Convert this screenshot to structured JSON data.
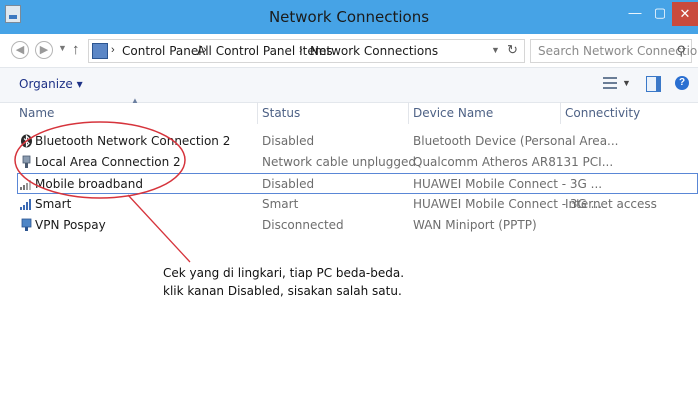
{
  "window": {
    "title": "Network Connections",
    "controls": {
      "minimize": "—",
      "maximize": "▢",
      "close": "✕"
    }
  },
  "address": {
    "breadcrumbs": [
      "Control Panel",
      "All Control Panel Items",
      "Network Connections"
    ],
    "search_placeholder": "Search Network Connections"
  },
  "toolbar": {
    "organize_label": "Organize ▾"
  },
  "columns": [
    "Name",
    "Status",
    "Device Name",
    "Connectivity"
  ],
  "rows": [
    {
      "name": "Bluetooth Network Connection 2",
      "status": "Disabled",
      "device": "Bluetooth Device (Personal Area...",
      "connectivity": "",
      "icon": "bluetooth-icon"
    },
    {
      "name": "Local Area Connection 2",
      "status": "Network cable unplugged",
      "device": "Qualcomm Atheros AR8131 PCI...",
      "connectivity": "",
      "icon": "ethernet-icon"
    },
    {
      "name": "Mobile broadband",
      "status": "Disabled",
      "device": "HUAWEI Mobile Connect - 3G ...",
      "connectivity": "",
      "icon": "signal-bars-icon"
    },
    {
      "name": "Smart",
      "status": "Smart",
      "device": "HUAWEI Mobile Connect - 3G ...",
      "connectivity": "Internet access",
      "icon": "mobile-network-icon"
    },
    {
      "name": "VPN Pospay",
      "status": "Disconnected",
      "device": "WAN Miniport (PPTP)",
      "connectivity": "",
      "icon": "vpn-icon"
    }
  ],
  "annotation": {
    "line1": "Cek yang di lingkari, tiap PC beda-beda.",
    "line2": "klik kanan Disabled, sisakan salah satu.",
    "color": "#d6343c"
  }
}
